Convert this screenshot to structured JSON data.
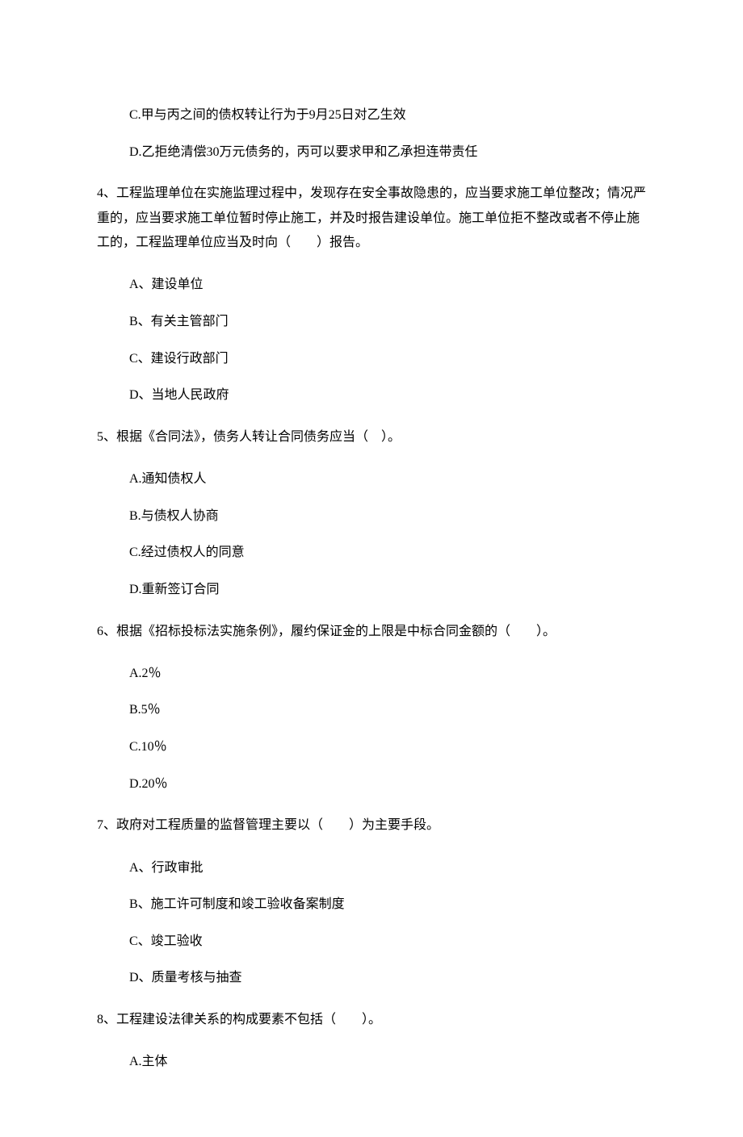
{
  "q3_continued": {
    "options": [
      "C.甲与丙之间的债权转让行为于9月25日对乙生效",
      "D.乙拒绝清偿30万元债务的，丙可以要求甲和乙承担连带责任"
    ]
  },
  "q4": {
    "text": "4、工程监理单位在实施监理过程中，发现存在安全事故隐患的，应当要求施工单位整改；情况严重的，应当要求施工单位暂时停止施工，并及时报告建设单位。施工单位拒不整改或者不停止施工的，工程监理单位应当及时向（　　）报告。",
    "options": [
      "A、建设单位",
      "B、有关主管部门",
      "C、建设行政部门",
      "D、当地人民政府"
    ]
  },
  "q5": {
    "text": "5、根据《合同法》，债务人转让合同债务应当（　）。",
    "options": [
      "A.通知债权人",
      "B.与债权人协商",
      "C.经过债权人的同意",
      "D.重新签订合同"
    ]
  },
  "q6": {
    "text": "6、根据《招标投标法实施条例》，履约保证金的上限是中标合同金额的（　　）。",
    "options": [
      "A.2％",
      "B.5％",
      "C.10％",
      "D.20％"
    ]
  },
  "q7": {
    "text": "7、政府对工程质量的监督管理主要以（　　）为主要手段。",
    "options": [
      "A、行政审批",
      "B、施工许可制度和竣工验收备案制度",
      "C、竣工验收",
      "D、质量考核与抽查"
    ]
  },
  "q8": {
    "text": "8、工程建设法律关系的构成要素不包括（　　）。",
    "options": [
      "A.主体"
    ]
  }
}
